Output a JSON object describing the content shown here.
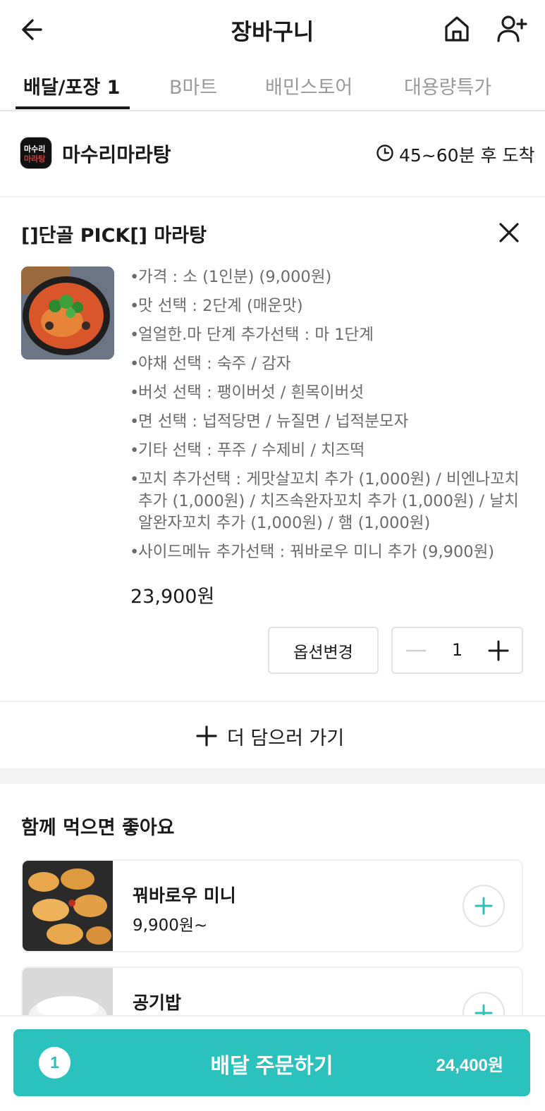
{
  "header": {
    "title": "장바구니"
  },
  "tabs": [
    {
      "label": "배달/포장 1",
      "active": true
    },
    {
      "label": "B마트",
      "active": false
    },
    {
      "label": "배민스토어",
      "active": false
    },
    {
      "label": "대용량특가",
      "active": false
    }
  ],
  "store": {
    "name": "마수리마라탕",
    "logo_text_top": "마수리",
    "logo_text_bottom": "마라탕",
    "eta": "45~60분 후 도착"
  },
  "cart_item": {
    "title": "[]단골 PICK[] 마라탕",
    "options": [
      "가격 : 소 (1인분) (9,000원)",
      "맛 선택 : 2단계 (매운맛)",
      "얼얼한.마 단계 추가선택 : 마 1단계",
      "야채 선택 : 숙주 / 감자",
      "버섯 선택 : 팽이버섯 / 흰목이버섯",
      "면 선택 : 넙적당면 / 뉴질면 / 넙적분모자",
      "기타 선택 : 푸주 / 수제비 / 치즈떡",
      "꼬치 추가선택 : 게맛살꼬치 추가 (1,000원) / 비엔나꼬치 추가 (1,000원) / 치즈속완자꼬치 추가 (1,000원) / 날치알완자꼬치 추가 (1,000원) / 햄 (1,000원)",
      "사이드메뉴 추가선택 : 꿔바로우 미니 추가 (9,900원)"
    ],
    "price": "23,900원",
    "change_option_label": "옵션변경",
    "quantity": "1"
  },
  "add_more_label": "더 담으러 가기",
  "recommendations": {
    "title": "함께 먹으면 좋아요",
    "items": [
      {
        "name": "꿔바로우 미니",
        "price": "9,900원~"
      },
      {
        "name": "공기밥",
        "price": ""
      }
    ]
  },
  "order": {
    "count": "1",
    "label": "배달 주문하기",
    "total": "24,400원"
  },
  "colors": {
    "accent": "#2bc1bc",
    "text": "#1a1a1a",
    "muted": "#6b6b6b"
  }
}
